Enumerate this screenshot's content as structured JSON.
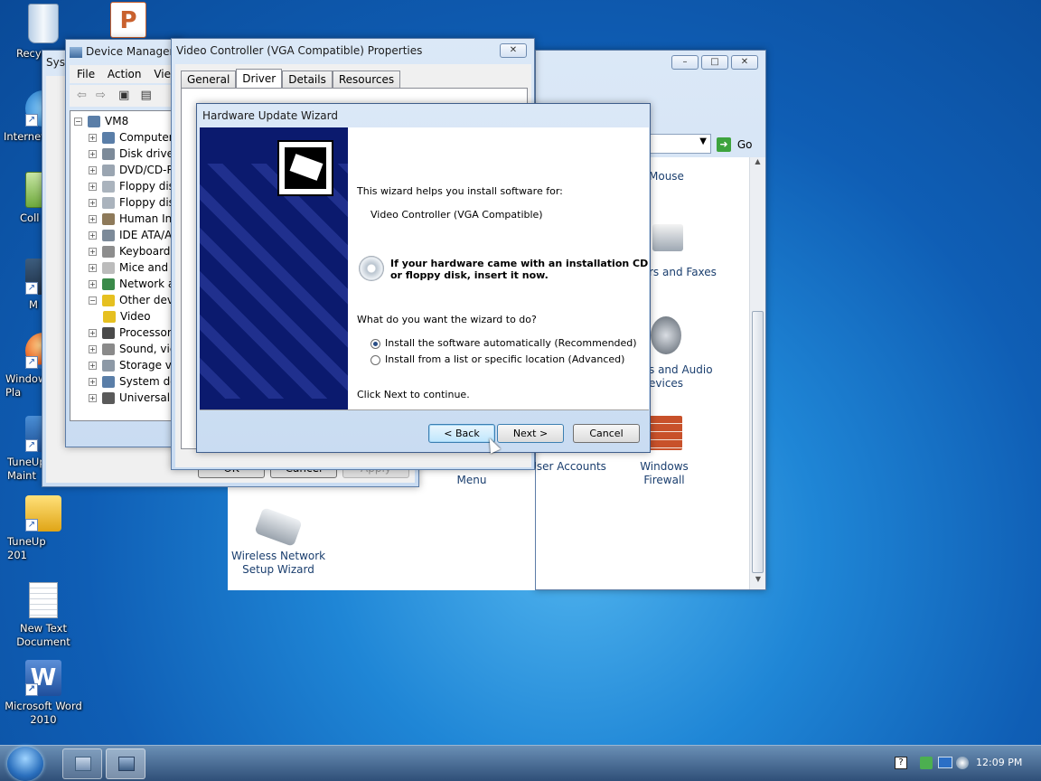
{
  "desktop": {
    "icons": [
      {
        "label": "Recyc",
        "icon": "recycle-bin-icon"
      },
      {
        "label": "Internet",
        "icon": "internet-explorer-icon"
      },
      {
        "label": "Coll",
        "icon": "collection-icon"
      },
      {
        "label": "M",
        "icon": "computer-icon"
      },
      {
        "label": "Window\nPla",
        "icon": "media-player-icon"
      },
      {
        "label": "TuneUp\nMaint",
        "icon": "tuneup-icon"
      },
      {
        "label": "TuneUp\n201",
        "icon": "tuneup-utilities-icon"
      },
      {
        "label": "New Text\nDocument",
        "icon": "text-document-icon"
      },
      {
        "label": "Microsoft Word\n2010",
        "icon": "word-icon"
      }
    ]
  },
  "control_panel": {
    "go_label": "Go",
    "items": [
      {
        "label": "Mouse"
      },
      {
        "label": "rs and Faxes"
      },
      {
        "label": "s and Audio\nevices"
      },
      {
        "label": "Taskbar and Start\nMenu"
      },
      {
        "label": "User Accounts"
      },
      {
        "label": "Windows Firewall"
      },
      {
        "label": "Wireless Network\nSetup Wizard"
      }
    ]
  },
  "system_props": {
    "title": "Syst",
    "ok": "OK",
    "cancel": "Cancel",
    "apply": "Apply"
  },
  "device_manager": {
    "title": "Device Manager",
    "menu": [
      "File",
      "Action",
      "View"
    ],
    "root": "VM8",
    "nodes": [
      "Computer",
      "Disk drives",
      "DVD/CD-R",
      "Floppy dis",
      "Floppy dis",
      "Human In",
      "IDE ATA/A",
      "Keyboards",
      "Mice and",
      "Network a",
      "Other dev",
      "Video",
      "Processors",
      "Sound, vic",
      "Storage vo",
      "System de",
      "Universal S"
    ]
  },
  "properties": {
    "title": "Video Controller (VGA Compatible) Properties",
    "tabs": [
      "General",
      "Driver",
      "Details",
      "Resources"
    ],
    "active_tab": "Driver"
  },
  "wizard": {
    "title": "Hardware Update Wizard",
    "intro": "This wizard helps you install software for:",
    "device": "Video Controller (VGA Compatible)",
    "cd_line1": "If your hardware came with an installation CD",
    "cd_line2": "or floppy disk, insert it now.",
    "question": "What do you want the wizard to do?",
    "options": [
      {
        "label": "Install the software automatically (Recommended)",
        "selected": true
      },
      {
        "label": "Install from a list or specific location (Advanced)",
        "selected": false
      }
    ],
    "footer": "Click Next to continue.",
    "back": "< Back",
    "next": "Next >",
    "cancel": "Cancel"
  },
  "taskbar": {
    "time": "12:09 PM"
  },
  "colors": {
    "wizard_banner": "#0b1a6e",
    "accent": "#3c7fb1"
  }
}
